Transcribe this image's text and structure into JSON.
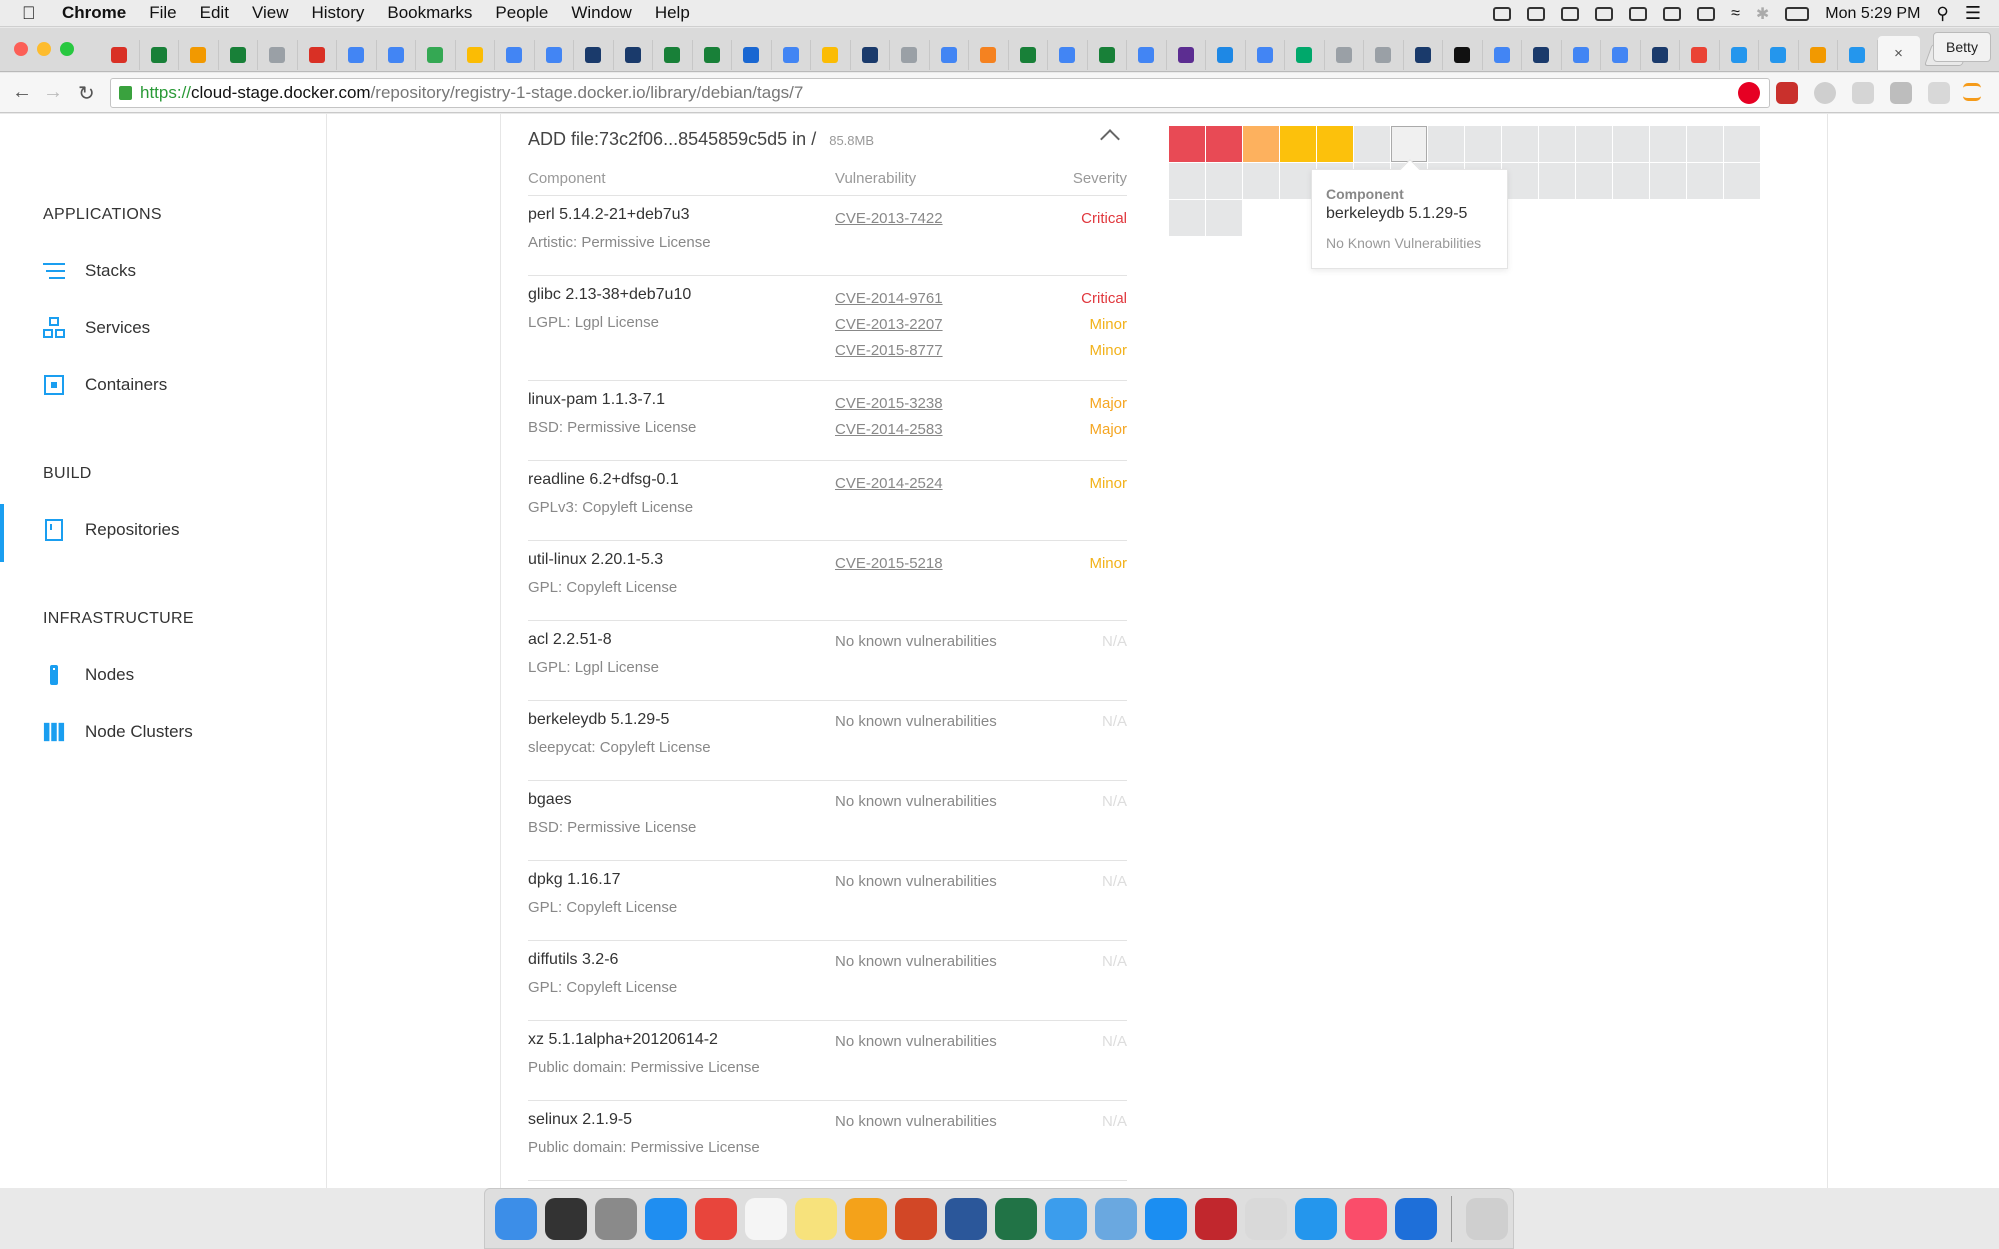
{
  "menubar": {
    "app": "Chrome",
    "items": [
      "File",
      "Edit",
      "View",
      "History",
      "Bookmarks",
      "People",
      "Window",
      "Help"
    ],
    "clock": "Mon 5:29 PM"
  },
  "browser": {
    "profile": "Betty",
    "close_tab": "×",
    "url_scheme": "https://",
    "url_host": "cloud-stage.docker.com",
    "url_path": "/repository/registry-1-stage.docker.io/library/debian/tags/7"
  },
  "sidebar": {
    "sections": [
      {
        "title": "APPLICATIONS",
        "items": [
          {
            "label": "Stacks",
            "icon": "stacks-icon"
          },
          {
            "label": "Services",
            "icon": "services-icon"
          },
          {
            "label": "Containers",
            "icon": "containers-icon"
          }
        ]
      },
      {
        "title": "BUILD",
        "items": [
          {
            "label": "Repositories",
            "icon": "repositories-icon"
          }
        ]
      },
      {
        "title": "INFRASTRUCTURE",
        "items": [
          {
            "label": "Nodes",
            "icon": "nodes-icon"
          },
          {
            "label": "Node Clusters",
            "icon": "node-clusters-icon"
          }
        ]
      }
    ]
  },
  "layer": {
    "command": "ADD file:73c2f06...8545859c5d5 in /",
    "size": "85.8MB"
  },
  "table": {
    "headers": {
      "component": "Component",
      "vulnerability": "Vulnerability",
      "severity": "Severity"
    },
    "rows": [
      {
        "component": "perl 5.14.2-21+deb7u3",
        "license": "Artistic: Permissive License",
        "cves": [
          {
            "id": "CVE-2013-7422",
            "severity": "Critical"
          }
        ]
      },
      {
        "component": "glibc 2.13-38+deb7u10",
        "license": "LGPL: Lgpl License",
        "cves": [
          {
            "id": "CVE-2014-9761",
            "severity": "Critical"
          },
          {
            "id": "CVE-2013-2207",
            "severity": "Minor"
          },
          {
            "id": "CVE-2015-8777",
            "severity": "Minor"
          }
        ]
      },
      {
        "component": "linux-pam 1.1.3-7.1",
        "license": "BSD: Permissive License",
        "cves": [
          {
            "id": "CVE-2015-3238",
            "severity": "Major"
          },
          {
            "id": "CVE-2014-2583",
            "severity": "Major"
          }
        ]
      },
      {
        "component": "readline 6.2+dfsg-0.1",
        "license": "GPLv3: Copyleft License",
        "cves": [
          {
            "id": "CVE-2014-2524",
            "severity": "Minor"
          }
        ]
      },
      {
        "component": "util-linux 2.20.1-5.3",
        "license": "GPL: Copyleft License",
        "cves": [
          {
            "id": "CVE-2015-5218",
            "severity": "Minor"
          }
        ]
      },
      {
        "component": "acl 2.2.51-8",
        "license": "LGPL: Lgpl License",
        "none": "No known vulnerabilities",
        "na": "N/A"
      },
      {
        "component": "berkeleydb 5.1.29-5",
        "license": "sleepycat: Copyleft License",
        "none": "No known vulnerabilities",
        "na": "N/A"
      },
      {
        "component": "bgaes",
        "license": "BSD: Permissive License",
        "none": "No known vulnerabilities",
        "na": "N/A"
      },
      {
        "component": "dpkg 1.16.17",
        "license": "GPL: Copyleft License",
        "none": "No known vulnerabilities",
        "na": "N/A"
      },
      {
        "component": "diffutils 3.2-6",
        "license": "GPL: Copyleft License",
        "none": "No known vulnerabilities",
        "na": "N/A"
      },
      {
        "component": "xz 5.1.1alpha+20120614-2",
        "license": "Public domain: Permissive License",
        "none": "No known vulnerabilities",
        "na": "N/A"
      },
      {
        "component": "selinux 2.1.9-5",
        "license": "Public domain: Permissive License",
        "none": "No known vulnerabilities",
        "na": "N/A"
      }
    ]
  },
  "grid": {
    "cells": [
      "critical",
      "critical",
      "major",
      "minor",
      "minor",
      "none",
      "none",
      "none",
      "none",
      "none",
      "none",
      "none",
      "none",
      "none",
      "none",
      "none",
      "none",
      "none",
      "none",
      "none",
      "none",
      "none",
      "none",
      "none",
      "none",
      "none",
      "none",
      "none",
      "none",
      "none",
      "none",
      "none",
      "none",
      "none"
    ],
    "hovered_index": 6
  },
  "tooltip": {
    "label": "Component",
    "value": "berkeleydb 5.1.29-5",
    "sub": "No Known Vulnerabilities"
  },
  "colors": {
    "critical": "#e84a55",
    "major": "#fdb15e",
    "minor": "#fcc10c",
    "none": "#e5e6e7",
    "accent": "#1a9ef0"
  }
}
